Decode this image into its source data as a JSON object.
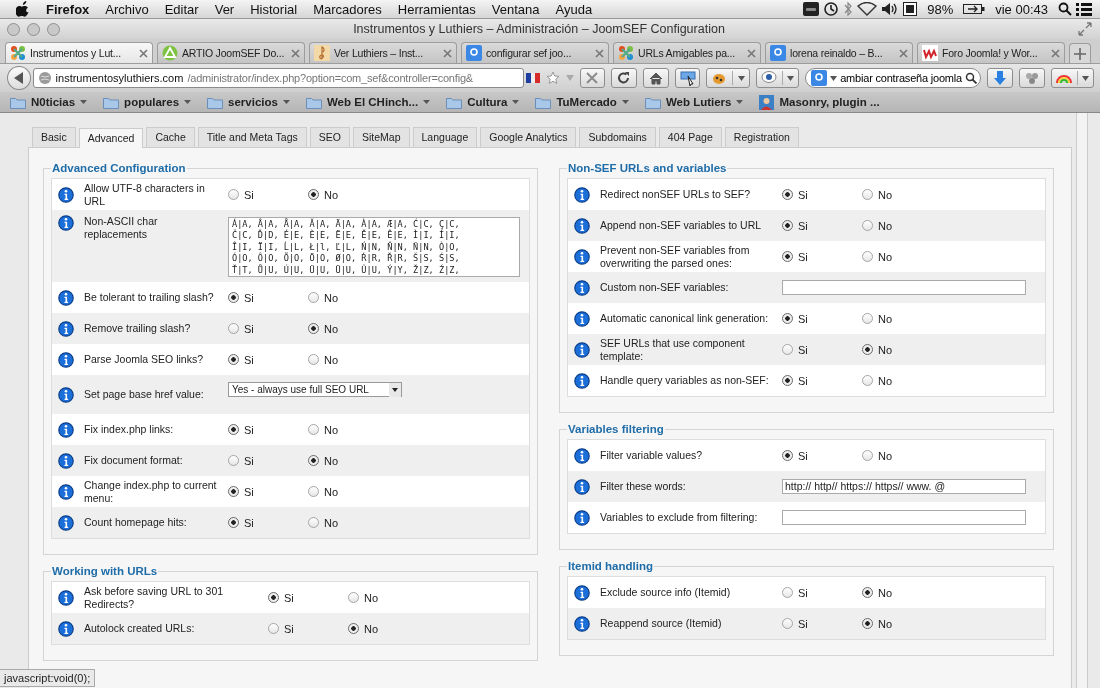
{
  "menubar": {
    "app": "Firefox",
    "items": [
      "Archivo",
      "Editar",
      "Ver",
      "Historial",
      "Marcadores",
      "Herramientas",
      "Ventana",
      "Ayuda"
    ],
    "battery": "98%",
    "clock": "vie 00:43"
  },
  "window": {
    "title": "Instrumentos y Luthiers – Administración – JoomSEF Configuration"
  },
  "browser_tabs": [
    {
      "title": "Instrumentos y Lut...",
      "kind": "pinwheel",
      "selected": true
    },
    {
      "title": "ARTIO JoomSEF Do...",
      "kind": "triangle",
      "selected": false
    },
    {
      "title": "Ver Luthiers – Inst...",
      "kind": "note",
      "selected": false
    },
    {
      "title": "configurar sef joo...",
      "kind": "tile",
      "selected": false
    },
    {
      "title": "URLs Amigables pa...",
      "kind": "pinwheel",
      "selected": false
    },
    {
      "title": "lorena reinaldo – B...",
      "kind": "tile",
      "selected": false
    },
    {
      "title": "Foro Joomla! y Wor...",
      "kind": "wave",
      "selected": false
    }
  ],
  "address": {
    "host": "instrumentosyluthiers.com",
    "path": "/administrator/index.php?option=com_sef&controller=config&"
  },
  "search": {
    "value": "ambiar contraseña joomla"
  },
  "bookmarks": [
    {
      "label": "N0ticias",
      "kind": "folder"
    },
    {
      "label": "populares",
      "kind": "folder"
    },
    {
      "label": "servicios",
      "kind": "folder"
    },
    {
      "label": "Web El CHinch...",
      "kind": "folder"
    },
    {
      "label": "Cultura",
      "kind": "folder"
    },
    {
      "label": "TuMercado",
      "kind": "folder"
    },
    {
      "label": "Web Lutiers",
      "kind": "folder"
    },
    {
      "label": "Masonry, plugin ...",
      "kind": "page"
    }
  ],
  "tabs": [
    {
      "label": "Basic",
      "selected": false
    },
    {
      "label": "Advanced",
      "selected": true
    },
    {
      "label": "Cache",
      "selected": false
    },
    {
      "label": "Title and Meta Tags",
      "selected": false
    },
    {
      "label": "SEO",
      "selected": false
    },
    {
      "label": "SiteMap",
      "selected": false
    },
    {
      "label": "Language",
      "selected": false
    },
    {
      "label": "Google Analytics",
      "selected": false
    },
    {
      "label": "Subdomains",
      "selected": false
    },
    {
      "label": "404 Page",
      "selected": false
    },
    {
      "label": "Registration",
      "selected": false
    }
  ],
  "columns": [
    {
      "sections": [
        {
          "title": "Advanced Configuration",
          "rows": [
            {
              "kind": "radio",
              "label": "Allow UTF-8 characters in URL",
              "options": [
                {
                  "label": "Si",
                  "selected": false
                },
                {
                  "label": "No",
                  "selected": true
                }
              ]
            },
            {
              "kind": "textarea",
              "label": "Non-ASCII char replacements",
              "value": "Á|A, Â|A, Å|A, Ă|A, Ä|A, À|A, Æ|A, Ć|C, Ç|C,\nČ|C, Ď|D, É|E, È|E, Ë|E, Ě|E, Ê|E, Ì|I, Í|I,\nÎ|I, Ï|I, Ĺ|L, Ł|l, Ľ|L, Ń|N, Ň|N, Ñ|N, Ò|O,\nÓ|O, Ô|O, Õ|O, Ö|O, Ø|O, Ŕ|R, Ř|R, Š|S, Ś|S,\nŤ|T, Ů|U, Ú|U, Ű|U, Ü|U, Û|U, Ý|Y, Ž|Z, Ź|Z,"
            },
            {
              "kind": "radio",
              "label": "Be tolerant to trailing slash?",
              "options": [
                {
                  "label": "Si",
                  "selected": true
                },
                {
                  "label": "No",
                  "selected": false
                }
              ]
            },
            {
              "kind": "radio",
              "label": "Remove trailing slash?",
              "options": [
                {
                  "label": "Si",
                  "selected": false
                },
                {
                  "label": "No",
                  "selected": true
                }
              ]
            },
            {
              "kind": "radio",
              "label": "Parse Joomla SEO links?",
              "options": [
                {
                  "label": "Si",
                  "selected": true
                },
                {
                  "label": "No",
                  "selected": false
                }
              ]
            },
            {
              "kind": "select",
              "label": "Set page base href value:",
              "value": "Yes - always use full SEO URL"
            },
            {
              "kind": "radio",
              "label": "Fix index.php links:",
              "options": [
                {
                  "label": "Si",
                  "selected": true
                },
                {
                  "label": "No",
                  "selected": false
                }
              ]
            },
            {
              "kind": "radio",
              "label": "Fix document format:",
              "options": [
                {
                  "label": "Si",
                  "selected": false
                },
                {
                  "label": "No",
                  "selected": true
                }
              ]
            },
            {
              "kind": "radio",
              "label": "Change index.php to current menu:",
              "options": [
                {
                  "label": "Si",
                  "selected": true
                },
                {
                  "label": "No",
                  "selected": false
                }
              ]
            },
            {
              "kind": "radio",
              "label": "Count homepage hits:",
              "options": [
                {
                  "label": "Si",
                  "selected": true
                },
                {
                  "label": "No",
                  "selected": false
                }
              ]
            }
          ]
        },
        {
          "title": "Working with URLs",
          "rows": [
            {
              "kind": "radio",
              "label": "Ask before saving URL to 301 Redirects?",
              "options": [
                {
                  "label": "Si",
                  "selected": true
                },
                {
                  "label": "No",
                  "selected": false
                }
              ]
            },
            {
              "kind": "radio",
              "label": "Autolock created URLs:",
              "options": [
                {
                  "label": "Si",
                  "selected": false
                },
                {
                  "label": "No",
                  "selected": true
                }
              ]
            }
          ]
        }
      ]
    },
    {
      "sections": [
        {
          "title": "Non-SEF URLs and variables",
          "rows": [
            {
              "kind": "radio",
              "label": "Redirect nonSEF URLs to SEF?",
              "options": [
                {
                  "label": "Si",
                  "selected": true
                },
                {
                  "label": "No",
                  "selected": false
                }
              ]
            },
            {
              "kind": "radio",
              "label": "Append non-SEF variables to URL",
              "options": [
                {
                  "label": "Si",
                  "selected": true
                },
                {
                  "label": "No",
                  "selected": false
                }
              ]
            },
            {
              "kind": "radio",
              "label": "Prevent non-SEF variables from overwriting the parsed ones:",
              "options": [
                {
                  "label": "Si",
                  "selected": true
                },
                {
                  "label": "No",
                  "selected": false
                }
              ]
            },
            {
              "kind": "text",
              "label": "Custom non-SEF variables:"
            },
            {
              "kind": "radio",
              "label": "Automatic canonical link generation:",
              "options": [
                {
                  "label": "Si",
                  "selected": true
                },
                {
                  "label": "No",
                  "selected": false
                }
              ]
            },
            {
              "kind": "radio",
              "label": "SEF URLs that use component template:",
              "options": [
                {
                  "label": "Si",
                  "selected": false
                },
                {
                  "label": "No",
                  "selected": true
                }
              ]
            },
            {
              "kind": "radio",
              "label": "Handle query variables as non-SEF:",
              "options": [
                {
                  "label": "Si",
                  "selected": true
                },
                {
                  "label": "No",
                  "selected": false
                }
              ]
            }
          ]
        },
        {
          "title": "Variables filtering",
          "rows": [
            {
              "kind": "radio",
              "label": "Filter variable values?",
              "options": [
                {
                  "label": "Si",
                  "selected": true
                },
                {
                  "label": "No",
                  "selected": false
                }
              ]
            },
            {
              "kind": "text",
              "label": "Filter these words:",
              "value": "http:// http// https:// https// www. @"
            },
            {
              "kind": "text",
              "label": "Variables to exclude from filtering:"
            }
          ]
        },
        {
          "title": "Itemid handling",
          "rows": [
            {
              "kind": "radio",
              "label": "Exclude source info (Itemid)",
              "options": [
                {
                  "label": "Si",
                  "selected": false
                },
                {
                  "label": "No",
                  "selected": true
                }
              ]
            },
            {
              "kind": "radio",
              "label": "Reappend source (Itemid)",
              "options": [
                {
                  "label": "Si",
                  "selected": false
                },
                {
                  "label": "No",
                  "selected": true
                }
              ]
            }
          ]
        }
      ]
    }
  ],
  "status_bar": {
    "text": "javascript:void(0);"
  }
}
